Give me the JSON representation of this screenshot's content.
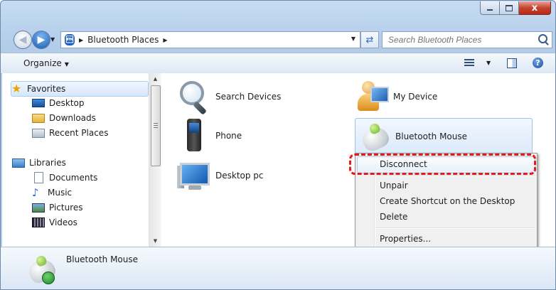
{
  "window": {
    "controls": {
      "minimize": "minimize",
      "maximize": "maximize",
      "close": "x"
    }
  },
  "address": {
    "breadcrumb": [
      "Bluetooth Places"
    ],
    "search_placeholder": "Search Bluetooth Places"
  },
  "toolbar": {
    "organize_label": "Organize",
    "help_glyph": "?"
  },
  "sidebar": {
    "favorites_label": "Favorites",
    "favorites": [
      "Desktop",
      "Downloads",
      "Recent Places"
    ],
    "libraries_label": "Libraries",
    "libraries": [
      "Documents",
      "Music",
      "Pictures",
      "Videos"
    ]
  },
  "content": {
    "items": [
      {
        "label": "Search Devices",
        "icon": "magnifier-icon"
      },
      {
        "label": "My Device",
        "icon": "user-computer-icon"
      },
      {
        "label": "Phone",
        "icon": "phone-icon"
      },
      {
        "label": "Bluetooth Mouse",
        "icon": "mouse-icon",
        "selected": true
      },
      {
        "label": "Desktop pc",
        "icon": "desktop-pc-icon"
      }
    ]
  },
  "context_menu": {
    "items": [
      "Disconnect",
      "Unpair",
      "Create Shortcut on the Desktop",
      "Delete",
      "Properties..."
    ],
    "highlighted": "Disconnect",
    "highlight_color": "#e21b1b"
  },
  "details_pane": {
    "title": "Bluetooth Mouse"
  }
}
